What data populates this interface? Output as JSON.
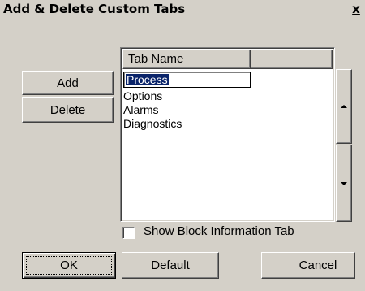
{
  "window": {
    "title": "Add & Delete Custom Tabs",
    "close_label": "x"
  },
  "buttons": {
    "add": "Add",
    "delete": "Delete",
    "ok": "OK",
    "default": "Default",
    "cancel": "Cancel"
  },
  "list": {
    "column_header": "Tab Name",
    "edit_value": "Process",
    "items": [
      "Process",
      "Options",
      "Alarms",
      "Diagnostics"
    ]
  },
  "checkbox": {
    "label": "Show Block Information Tab",
    "checked": false
  },
  "move": {
    "up_icon": "triangle-up-icon",
    "down_icon": "triangle-down-icon"
  }
}
